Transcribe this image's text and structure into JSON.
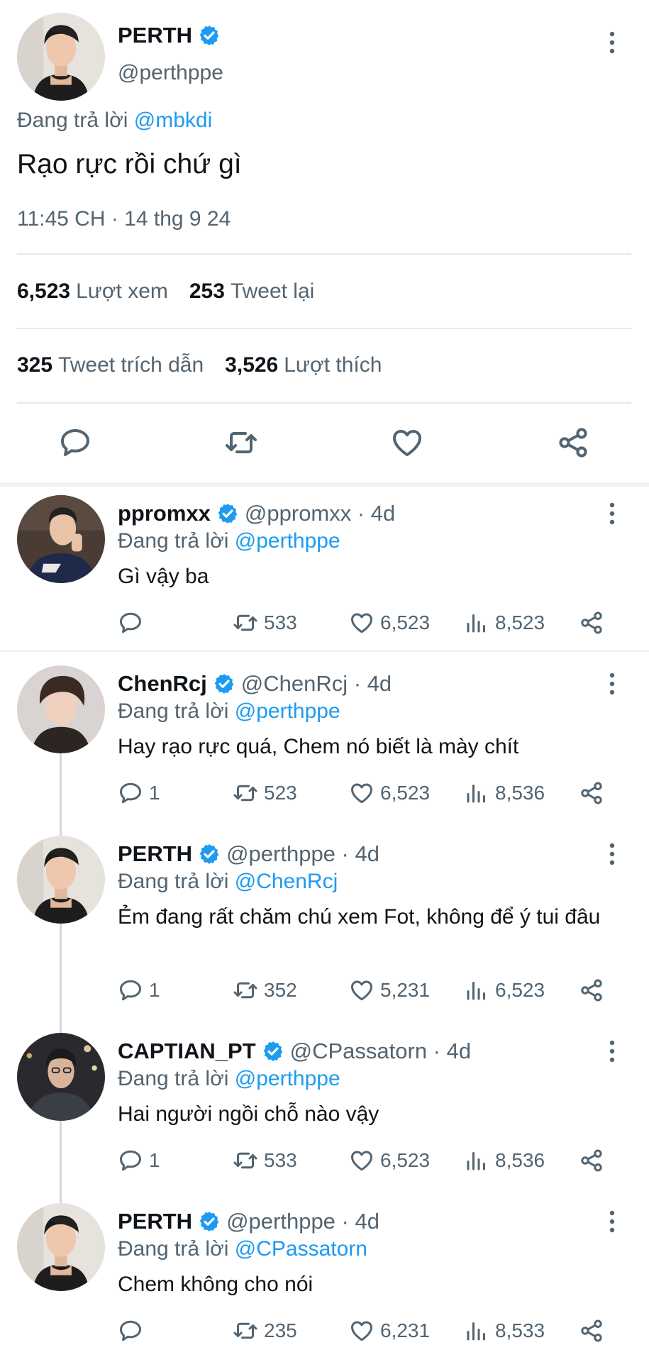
{
  "colors": {
    "link": "#1d9bf0",
    "secondary": "#536471",
    "verified": "#1d9bf0"
  },
  "main": {
    "name": "PERTH",
    "handle": "@perthppe",
    "reply_prefix": "Đang trả lời",
    "reply_to": "@mbkdi",
    "text": "Rạo rực rồi chứ gì",
    "timestamp": "11:45 CH · 14 thg 9 24",
    "stats": [
      {
        "value": "6,523",
        "label": "Lượt xem"
      },
      {
        "value": "253",
        "label": "Tweet lại"
      },
      {
        "value": "325",
        "label": "Tweet trích dẫn"
      },
      {
        "value": "3,526",
        "label": "Lượt thích"
      }
    ],
    "action_icons": [
      "reply-icon",
      "retweet-icon",
      "like-icon",
      "share-icon"
    ]
  },
  "replies": [
    {
      "name": "ppromxx",
      "handle": "@ppromxx · 4d",
      "reply_prefix": "Đang trả lời",
      "reply_to": "@perthppe",
      "text": "Gì vậy ba",
      "replies": "",
      "retweets": "533",
      "likes": "6,523",
      "views": "8,523"
    },
    {
      "name": "ChenRcj",
      "handle": "@ChenRcj · 4d",
      "reply_prefix": "Đang trả lời",
      "reply_to": "@perthppe",
      "text": "Hay rạo rực quá, Chem nó biết là mày chít",
      "replies": "1",
      "retweets": "523",
      "likes": "6,523",
      "views": "8,536"
    },
    {
      "name": "PERTH",
      "handle": "@perthppe · 4d",
      "reply_prefix": "Đang trả lời",
      "reply_to": "@ChenRcj",
      "text": "Ẻm đang rất chăm chú xem Fot, không để ý tui đâu",
      "replies": "1",
      "retweets": "352",
      "likes": "5,231",
      "views": "6,523"
    },
    {
      "name": "CAPTIAN_PT",
      "handle": "@CPassatorn · 4d",
      "reply_prefix": "Đang trả lời",
      "reply_to": "@perthppe",
      "text": "Hai người ngồi chỗ nào vậy",
      "replies": "1",
      "retweets": "533",
      "likes": "6,523",
      "views": "8,536"
    },
    {
      "name": "PERTH",
      "handle": "@perthppe · 4d",
      "reply_prefix": "Đang trả lời",
      "reply_to": "@CPassatorn",
      "text": "Chem không cho nói",
      "replies": "",
      "retweets": "235",
      "likes": "6,231",
      "views": "8,533"
    }
  ]
}
